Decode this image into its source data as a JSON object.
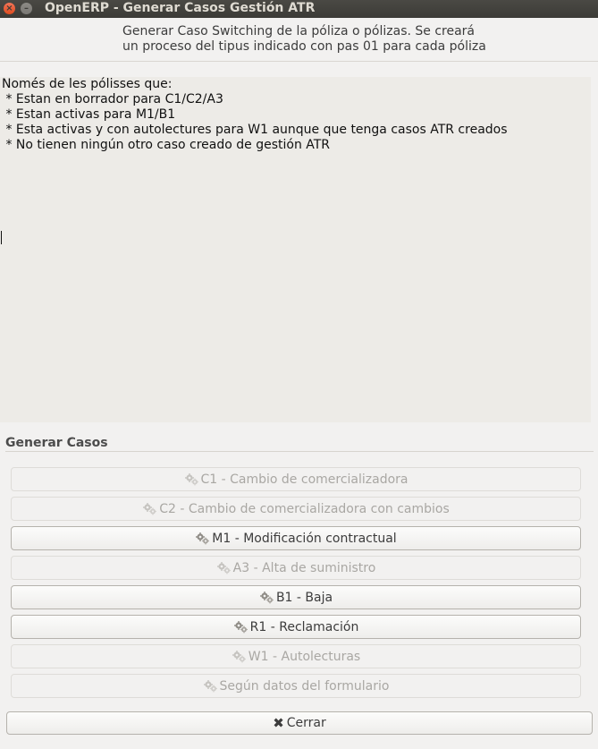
{
  "window": {
    "title": "OpenERP - Generar Casos Gestión ATR",
    "close_glyph": "×",
    "minimize_glyph": "–"
  },
  "header": {
    "line1": "Generar Caso Switching de la póliza o pólizas. Se creará",
    "line2": "un proceso del tipus indicado con pas 01 para cada póliza"
  },
  "info": {
    "text": "Només de les pólisses que:\n * Estan en borrador para C1/C2/A3\n * Estan activas para M1/B1\n * Esta activas y con autolectures para W1 aunque que tenga casos ATR creados\n * No tienen ningún otro caso creado de gestión ATR"
  },
  "section": {
    "title": "Generar Casos"
  },
  "buttons": [
    {
      "label": "C1 - Cambio de comercializadora",
      "enabled": false,
      "icon": "gears-icon"
    },
    {
      "label": "C2 - Cambio de comercializadora con cambios",
      "enabled": false,
      "icon": "gears-icon"
    },
    {
      "label": "M1 - Modificación contractual",
      "enabled": true,
      "icon": "gears-icon"
    },
    {
      "label": "A3 - Alta de suministro",
      "enabled": false,
      "icon": "gears-icon"
    },
    {
      "label": "B1 - Baja",
      "enabled": true,
      "icon": "gears-icon"
    },
    {
      "label": "R1 - Reclamación",
      "enabled": true,
      "icon": "gears-icon"
    },
    {
      "label": "W1 - Autolecturas",
      "enabled": false,
      "icon": "gears-icon"
    },
    {
      "label": "Según datos del formulario",
      "enabled": false,
      "icon": "gears-icon"
    }
  ],
  "footer": {
    "close_label": "Cerrar",
    "close_icon": "✖"
  }
}
